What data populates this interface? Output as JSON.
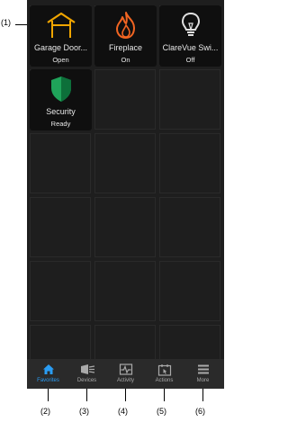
{
  "tiles": [
    {
      "name": "Garage Door...",
      "state": "Open",
      "icon": "garage-icon",
      "color": "#f0a500"
    },
    {
      "name": "Fireplace",
      "state": "On",
      "icon": "fire-icon",
      "color": "#f26522"
    },
    {
      "name": "ClareVue Swi...",
      "state": "Off",
      "icon": "lightbulb-icon",
      "color": "#e0e0e0"
    },
    {
      "name": "Security",
      "state": "Ready",
      "icon": "shield-icon",
      "color": "#1fa35a"
    }
  ],
  "tabs": [
    {
      "label": "Favorites",
      "icon": "home-icon",
      "active": true
    },
    {
      "label": "Devices",
      "icon": "devices-icon",
      "active": false
    },
    {
      "label": "Activity",
      "icon": "activity-icon",
      "active": false
    },
    {
      "label": "Actions",
      "icon": "actions-icon",
      "active": false
    },
    {
      "label": "More",
      "icon": "menu-icon",
      "active": false
    }
  ],
  "callouts": [
    "(1)",
    "(2)",
    "(3)",
    "(4)",
    "(5)",
    "(6)"
  ],
  "colors": {
    "accent": "#2a9df4",
    "background": "#1e1e1e",
    "tile": "#0f0f0f"
  }
}
